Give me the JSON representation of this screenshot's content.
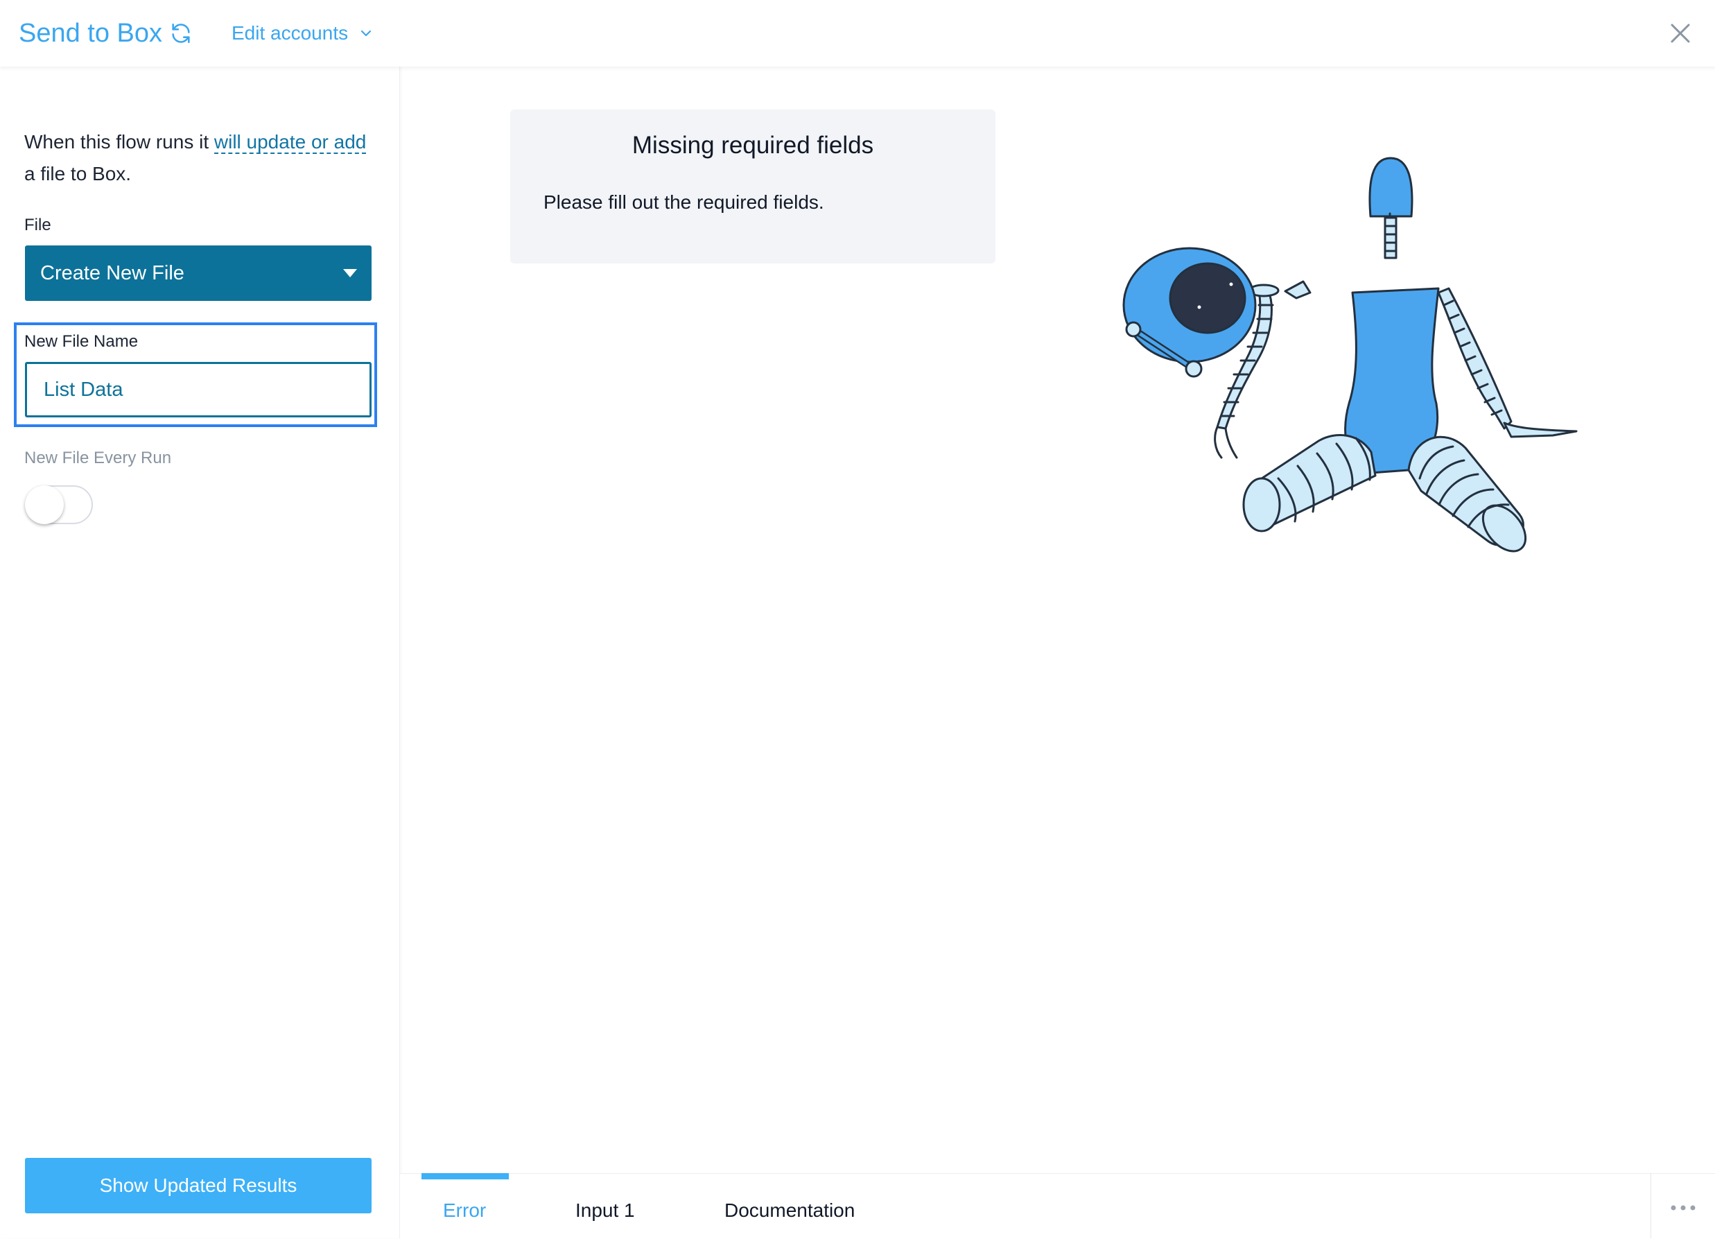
{
  "header": {
    "title": "Send to Box",
    "refresh_icon": "refresh-icon",
    "edit_accounts_label": "Edit accounts",
    "close_icon": "close-icon"
  },
  "sidebar": {
    "description_prefix": "When this flow runs it ",
    "description_link": "will update or add",
    "description_suffix": " a file to Box.",
    "file_label": "File",
    "file_select_value": "Create New File",
    "new_file_name_label": "New File Name",
    "new_file_name_value": "List Data",
    "new_file_every_run_label": "New File Every Run",
    "new_file_every_run_on": false,
    "show_results_label": "Show Updated Results"
  },
  "main": {
    "alert_title": "Missing required fields",
    "alert_message": "Please fill out the required fields."
  },
  "tabs": [
    {
      "label": "Error",
      "active": true
    },
    {
      "label": "Input 1",
      "active": false
    },
    {
      "label": "Documentation",
      "active": false
    }
  ],
  "colors": {
    "accent": "#3aa6ef",
    "primary": "#0d7299",
    "focus": "#2d80f0",
    "button": "#3db0f7",
    "alert_bg": "#f2f4f7"
  }
}
